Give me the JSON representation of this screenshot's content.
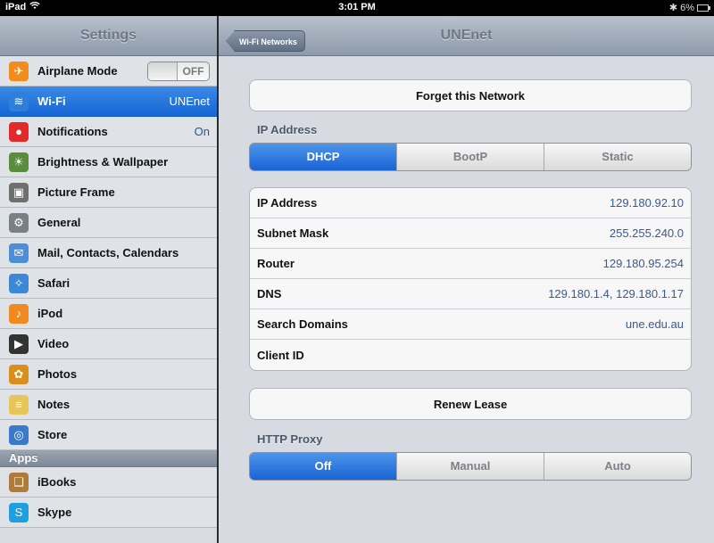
{
  "status_bar": {
    "device": "iPad",
    "time": "3:01 PM",
    "battery": "6%"
  },
  "sidebar": {
    "title": "Settings",
    "items": [
      {
        "label": "Airplane Mode",
        "value": "",
        "toggle": "OFF",
        "icon": "airplane-icon",
        "color": "#f28c1c"
      },
      {
        "label": "Wi-Fi",
        "value": "UNEnet",
        "icon": "wifi-icon",
        "color": "#2e7fd9",
        "selected": true
      },
      {
        "label": "Notifications",
        "value": "On",
        "icon": "notifications-icon",
        "color": "#e32a2a"
      },
      {
        "label": "Brightness & Wallpaper",
        "value": "",
        "icon": "brightness-icon",
        "color": "#5a8c3d"
      },
      {
        "label": "Picture Frame",
        "value": "",
        "icon": "picture-frame-icon",
        "color": "#6f6f6f"
      },
      {
        "label": "General",
        "value": "",
        "icon": "gear-icon",
        "color": "#7a7f86"
      },
      {
        "label": "Mail, Contacts, Calendars",
        "value": "",
        "icon": "mail-icon",
        "color": "#4c8fd8"
      },
      {
        "label": "Safari",
        "value": "",
        "icon": "compass-icon",
        "color": "#3d88d6"
      },
      {
        "label": "iPod",
        "value": "",
        "icon": "ipod-icon",
        "color": "#f08a1e"
      },
      {
        "label": "Video",
        "value": "",
        "icon": "video-icon",
        "color": "#333333"
      },
      {
        "label": "Photos",
        "value": "",
        "icon": "flower-icon",
        "color": "#d98f1c"
      },
      {
        "label": "Notes",
        "value": "",
        "icon": "notes-icon",
        "color": "#e8c558"
      },
      {
        "label": "Store",
        "value": "",
        "icon": "store-icon",
        "color": "#3a7ac8"
      }
    ],
    "apps_header": "Apps",
    "apps": [
      {
        "label": "iBooks",
        "icon": "book-icon",
        "color": "#b07a3a"
      },
      {
        "label": "Skype",
        "icon": "skype-icon",
        "color": "#1ea0e0"
      }
    ]
  },
  "detail": {
    "back_label": "Wi-Fi Networks",
    "title": "UNEnet",
    "forget_label": "Forget this Network",
    "ip_section_label": "IP Address",
    "ip_modes": [
      "DHCP",
      "BootP",
      "Static"
    ],
    "ip_mode_selected": "DHCP",
    "fields": [
      {
        "key": "IP Address",
        "value": "129.180.92.10"
      },
      {
        "key": "Subnet Mask",
        "value": "255.255.240.0"
      },
      {
        "key": "Router",
        "value": "129.180.95.254"
      },
      {
        "key": "DNS",
        "value": "129.180.1.4, 129.180.1.17"
      },
      {
        "key": "Search Domains",
        "value": "une.edu.au"
      },
      {
        "key": "Client ID",
        "value": ""
      }
    ],
    "renew_label": "Renew Lease",
    "proxy_section_label": "HTTP Proxy",
    "proxy_modes": [
      "Off",
      "Manual",
      "Auto"
    ],
    "proxy_mode_selected": "Off"
  },
  "colors": {
    "accent_blue": "#1963d4",
    "value_blue": "#3b5890"
  }
}
